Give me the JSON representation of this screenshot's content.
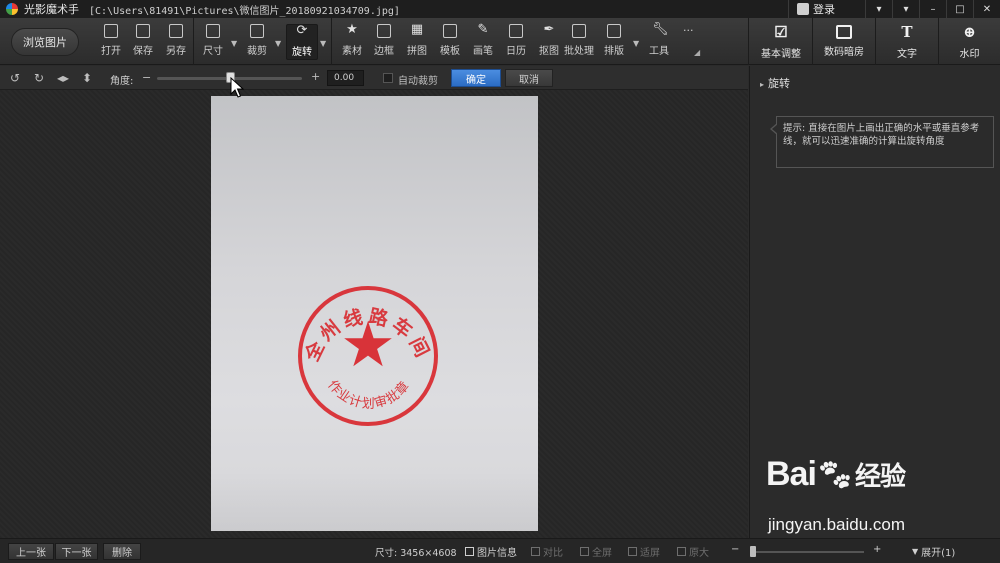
{
  "window": {
    "app_title": "光影魔术手",
    "file_path": "[C:\\Users\\81491\\Pictures\\微信图片_20180921034709.jpg]",
    "login_label": "登录",
    "controls": [
      "▾",
      "▾",
      "–",
      "□",
      "✕"
    ]
  },
  "toolbar": {
    "browse_label": "浏览图片",
    "tools": [
      {
        "label": "打开",
        "icon": "open-icon"
      },
      {
        "label": "保存",
        "icon": "save-icon"
      },
      {
        "label": "另存",
        "icon": "save-as-icon"
      },
      {
        "label": "尺寸",
        "icon": "resize-icon"
      },
      {
        "label": "裁剪",
        "icon": "crop-icon"
      },
      {
        "label": "旋转",
        "icon": "rotate-icon"
      },
      {
        "label": "素材",
        "icon": "material-icon"
      },
      {
        "label": "边框",
        "icon": "border-icon"
      },
      {
        "label": "拼图",
        "icon": "collage-icon"
      },
      {
        "label": "模板",
        "icon": "template-icon"
      },
      {
        "label": "画笔",
        "icon": "brush-icon"
      },
      {
        "label": "日历",
        "icon": "calendar-icon"
      },
      {
        "label": "抠图",
        "icon": "cutout-icon"
      },
      {
        "label": "批处理",
        "icon": "batch-icon"
      },
      {
        "label": "排版",
        "icon": "layout-icon"
      },
      {
        "label": "工具",
        "icon": "wrench-icon"
      }
    ],
    "more_label": "···",
    "right_tools": [
      {
        "label": "基本调整",
        "icon": "adjust-icon"
      },
      {
        "label": "数码暗房",
        "icon": "camera-icon"
      },
      {
        "label": "文字",
        "icon": "text-icon"
      },
      {
        "label": "水印",
        "icon": "watermark-icon"
      }
    ]
  },
  "rotate_bar": {
    "angle_label": "角度:",
    "minus": "−",
    "plus": "+",
    "angle_value": "0.00",
    "auto_crop_label": "自动裁剪",
    "ok_label": "确定",
    "cancel_label": "取消",
    "slider_position": 0.5
  },
  "right_panel": {
    "section_title": "旋转",
    "tip": "提示: 直接在图片上画出正确的水平或垂直参考线，就可以迅速准确的计算出旋转角度"
  },
  "seal": {
    "top_text": [
      "全",
      "州",
      "线",
      "路",
      "车",
      "间"
    ],
    "bottom_text": "作业计划审批章",
    "color": "#d8252a"
  },
  "watermark": {
    "brand": "Bai",
    "brand_tail": "经验",
    "url": "jingyan.baidu.com"
  },
  "statusbar": {
    "prev_label": "上一张",
    "next_label": "下一张",
    "delete_label": "删除",
    "size_text": "尺寸: 3456×4608",
    "info_label": "图片信息",
    "compare_label": "对比",
    "fullscreen_label": "全屏",
    "fit_label": "适屏",
    "original_label": "原大",
    "zoom_minus": "−",
    "zoom_plus": "+",
    "expand_label": "展开(1)"
  },
  "colors": {
    "accent": "#2b6cc4",
    "background": "#2b2b2b"
  }
}
